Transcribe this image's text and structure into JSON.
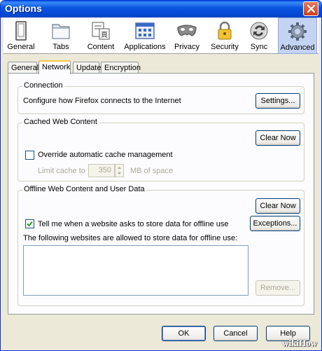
{
  "window": {
    "title": "Options"
  },
  "toolbar": {
    "items": [
      {
        "label": "General",
        "icon": "general-icon"
      },
      {
        "label": "Tabs",
        "icon": "tabs-icon"
      },
      {
        "label": "Content",
        "icon": "content-icon"
      },
      {
        "label": "Applications",
        "icon": "applications-icon"
      },
      {
        "label": "Privacy",
        "icon": "privacy-icon"
      },
      {
        "label": "Security",
        "icon": "security-icon"
      },
      {
        "label": "Sync",
        "icon": "sync-icon"
      },
      {
        "label": "Advanced",
        "icon": "advanced-icon",
        "selected": true
      }
    ]
  },
  "tabs": [
    {
      "label": "General"
    },
    {
      "label": "Network",
      "selected": true
    },
    {
      "label": "Update"
    },
    {
      "label": "Encryption"
    }
  ],
  "connection": {
    "title": "Connection",
    "description": "Configure how Firefox connects to the Internet",
    "settings_button": "Settings..."
  },
  "cache": {
    "title": "Cached Web Content",
    "clear_button": "Clear Now",
    "override_label": "Override automatic cache management",
    "override_checked": false,
    "limit_label": "Limit cache to",
    "limit_value": "350",
    "limit_unit": "MB of space"
  },
  "offline": {
    "title": "Offline Web Content and User Data",
    "clear_button": "Clear Now",
    "tell_me_label": "Tell me when a website asks to store data for offline use",
    "tell_me_checked": true,
    "exceptions_button": "Exceptions...",
    "allowed_label": "The following websites are allowed to store data for offline use:",
    "remove_button": "Remove..."
  },
  "footer": {
    "ok": "OK",
    "cancel": "Cancel",
    "help": "Help"
  },
  "watermark": "wikiHow",
  "colors": {
    "titlebar": "#0a57e0",
    "dialog_bg": "#ece9d8",
    "selected_toolbar": "#c3d3f2"
  }
}
